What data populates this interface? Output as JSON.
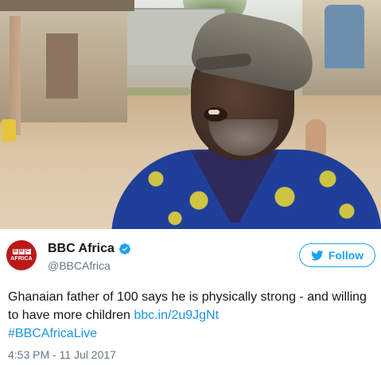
{
  "tweet": {
    "image": {
      "alt": "",
      "icon": "photo"
    },
    "author": {
      "display_name": "BBC Africa",
      "handle": "@BBCAfrica",
      "verified": true,
      "avatar": {
        "logo_letters": [
          "B",
          "B",
          "C"
        ],
        "word": "AFRICA"
      }
    },
    "follow_button": {
      "label": "Follow",
      "icon": "twitter-bird-icon"
    },
    "text": {
      "body": "Ghanaian father of 100 says he is physically strong - and willing to have more children ",
      "link": "bbc.in/2u9JgNt",
      "hashtag": "#BBCAfricaLive"
    },
    "timestamp": "4:53 PM - 11 Jul 2017"
  },
  "colors": {
    "brand_red": "#bb1919",
    "twitter_blue": "#1da1f2",
    "link_blue": "#1b95e0",
    "text_primary": "#14171a",
    "text_secondary": "#657786"
  }
}
